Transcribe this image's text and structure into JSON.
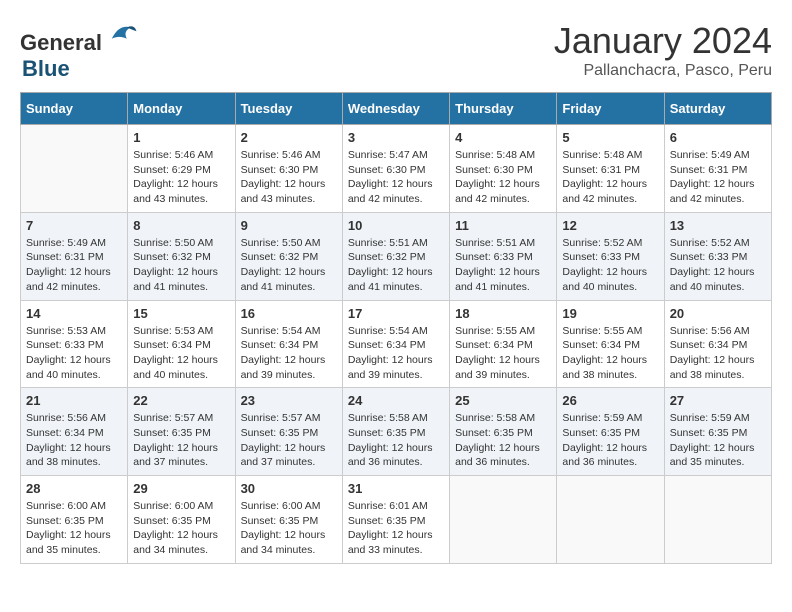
{
  "logo": {
    "general": "General",
    "blue": "Blue"
  },
  "header": {
    "month": "January 2024",
    "location": "Pallanchacra, Pasco, Peru"
  },
  "days_of_week": [
    "Sunday",
    "Monday",
    "Tuesday",
    "Wednesday",
    "Thursday",
    "Friday",
    "Saturday"
  ],
  "weeks": [
    [
      {
        "day": "",
        "info": ""
      },
      {
        "day": "1",
        "info": "Sunrise: 5:46 AM\nSunset: 6:29 PM\nDaylight: 12 hours\nand 43 minutes."
      },
      {
        "day": "2",
        "info": "Sunrise: 5:46 AM\nSunset: 6:30 PM\nDaylight: 12 hours\nand 43 minutes."
      },
      {
        "day": "3",
        "info": "Sunrise: 5:47 AM\nSunset: 6:30 PM\nDaylight: 12 hours\nand 42 minutes."
      },
      {
        "day": "4",
        "info": "Sunrise: 5:48 AM\nSunset: 6:30 PM\nDaylight: 12 hours\nand 42 minutes."
      },
      {
        "day": "5",
        "info": "Sunrise: 5:48 AM\nSunset: 6:31 PM\nDaylight: 12 hours\nand 42 minutes."
      },
      {
        "day": "6",
        "info": "Sunrise: 5:49 AM\nSunset: 6:31 PM\nDaylight: 12 hours\nand 42 minutes."
      }
    ],
    [
      {
        "day": "7",
        "info": "Sunrise: 5:49 AM\nSunset: 6:31 PM\nDaylight: 12 hours\nand 42 minutes."
      },
      {
        "day": "8",
        "info": "Sunrise: 5:50 AM\nSunset: 6:32 PM\nDaylight: 12 hours\nand 41 minutes."
      },
      {
        "day": "9",
        "info": "Sunrise: 5:50 AM\nSunset: 6:32 PM\nDaylight: 12 hours\nand 41 minutes."
      },
      {
        "day": "10",
        "info": "Sunrise: 5:51 AM\nSunset: 6:32 PM\nDaylight: 12 hours\nand 41 minutes."
      },
      {
        "day": "11",
        "info": "Sunrise: 5:51 AM\nSunset: 6:33 PM\nDaylight: 12 hours\nand 41 minutes."
      },
      {
        "day": "12",
        "info": "Sunrise: 5:52 AM\nSunset: 6:33 PM\nDaylight: 12 hours\nand 40 minutes."
      },
      {
        "day": "13",
        "info": "Sunrise: 5:52 AM\nSunset: 6:33 PM\nDaylight: 12 hours\nand 40 minutes."
      }
    ],
    [
      {
        "day": "14",
        "info": "Sunrise: 5:53 AM\nSunset: 6:33 PM\nDaylight: 12 hours\nand 40 minutes."
      },
      {
        "day": "15",
        "info": "Sunrise: 5:53 AM\nSunset: 6:34 PM\nDaylight: 12 hours\nand 40 minutes."
      },
      {
        "day": "16",
        "info": "Sunrise: 5:54 AM\nSunset: 6:34 PM\nDaylight: 12 hours\nand 39 minutes."
      },
      {
        "day": "17",
        "info": "Sunrise: 5:54 AM\nSunset: 6:34 PM\nDaylight: 12 hours\nand 39 minutes."
      },
      {
        "day": "18",
        "info": "Sunrise: 5:55 AM\nSunset: 6:34 PM\nDaylight: 12 hours\nand 39 minutes."
      },
      {
        "day": "19",
        "info": "Sunrise: 5:55 AM\nSunset: 6:34 PM\nDaylight: 12 hours\nand 38 minutes."
      },
      {
        "day": "20",
        "info": "Sunrise: 5:56 AM\nSunset: 6:34 PM\nDaylight: 12 hours\nand 38 minutes."
      }
    ],
    [
      {
        "day": "21",
        "info": "Sunrise: 5:56 AM\nSunset: 6:34 PM\nDaylight: 12 hours\nand 38 minutes."
      },
      {
        "day": "22",
        "info": "Sunrise: 5:57 AM\nSunset: 6:35 PM\nDaylight: 12 hours\nand 37 minutes."
      },
      {
        "day": "23",
        "info": "Sunrise: 5:57 AM\nSunset: 6:35 PM\nDaylight: 12 hours\nand 37 minutes."
      },
      {
        "day": "24",
        "info": "Sunrise: 5:58 AM\nSunset: 6:35 PM\nDaylight: 12 hours\nand 36 minutes."
      },
      {
        "day": "25",
        "info": "Sunrise: 5:58 AM\nSunset: 6:35 PM\nDaylight: 12 hours\nand 36 minutes."
      },
      {
        "day": "26",
        "info": "Sunrise: 5:59 AM\nSunset: 6:35 PM\nDaylight: 12 hours\nand 36 minutes."
      },
      {
        "day": "27",
        "info": "Sunrise: 5:59 AM\nSunset: 6:35 PM\nDaylight: 12 hours\nand 35 minutes."
      }
    ],
    [
      {
        "day": "28",
        "info": "Sunrise: 6:00 AM\nSunset: 6:35 PM\nDaylight: 12 hours\nand 35 minutes."
      },
      {
        "day": "29",
        "info": "Sunrise: 6:00 AM\nSunset: 6:35 PM\nDaylight: 12 hours\nand 34 minutes."
      },
      {
        "day": "30",
        "info": "Sunrise: 6:00 AM\nSunset: 6:35 PM\nDaylight: 12 hours\nand 34 minutes."
      },
      {
        "day": "31",
        "info": "Sunrise: 6:01 AM\nSunset: 6:35 PM\nDaylight: 12 hours\nand 33 minutes."
      },
      {
        "day": "",
        "info": ""
      },
      {
        "day": "",
        "info": ""
      },
      {
        "day": "",
        "info": ""
      }
    ]
  ]
}
